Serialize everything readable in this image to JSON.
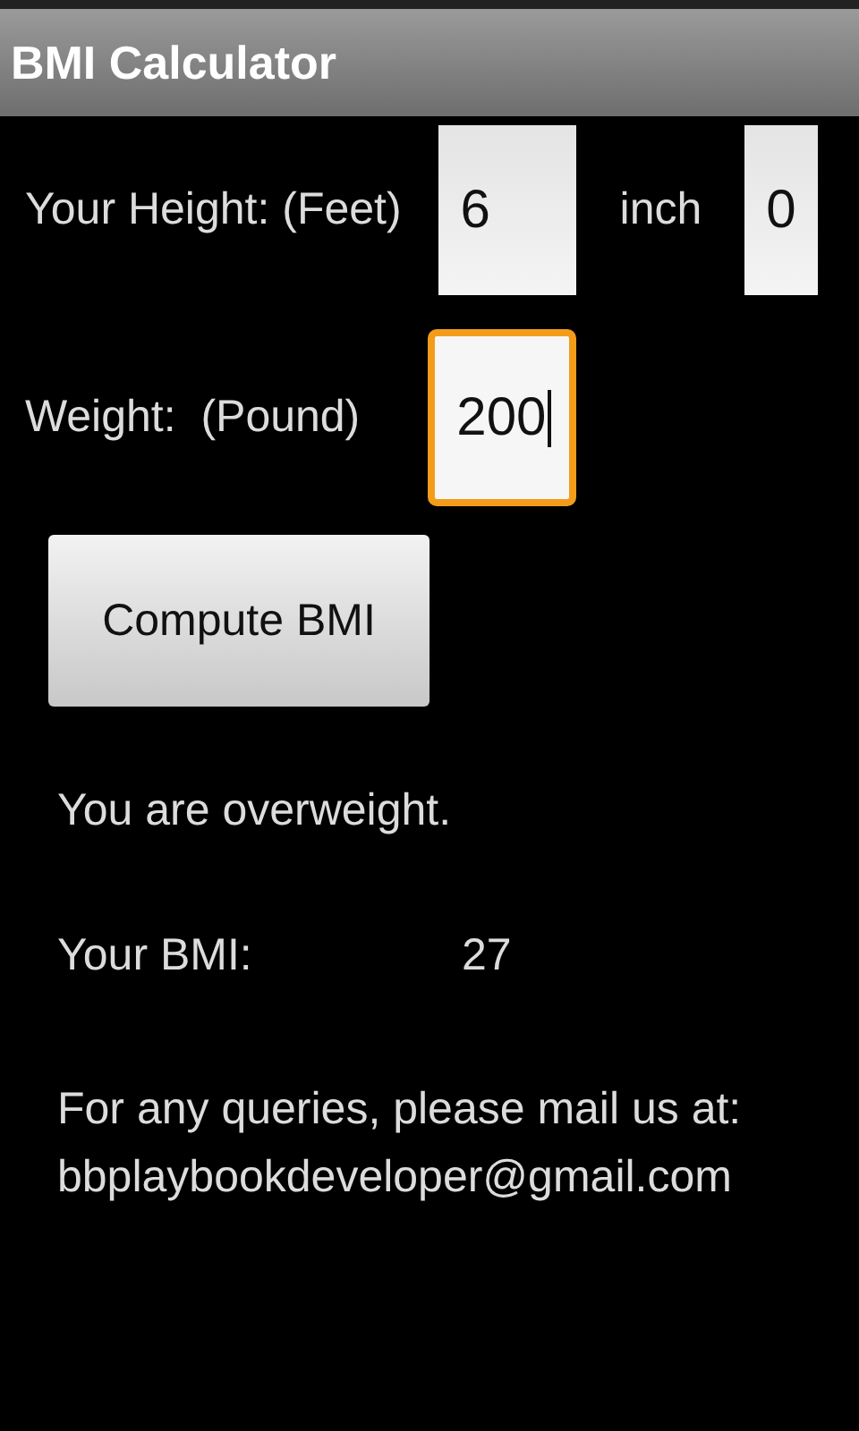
{
  "window": {
    "title": "BMI Calculator"
  },
  "height": {
    "label": "Your Height: (Feet)",
    "feet": {
      "value": "6",
      "focused": false
    },
    "inch_label": "inch",
    "inch": {
      "value": "0",
      "focused": false
    }
  },
  "weight": {
    "label": "Weight:  (Pound)",
    "field": {
      "value": "200",
      "focused": true
    }
  },
  "compute_button": "Compute BMI",
  "result": "You are overweight.",
  "bmi": {
    "label": "Your BMI:",
    "value": "27"
  },
  "contact": {
    "text": "For any queries, please mail us at:",
    "email": "bbplaybookdeveloper@gmail.com"
  }
}
